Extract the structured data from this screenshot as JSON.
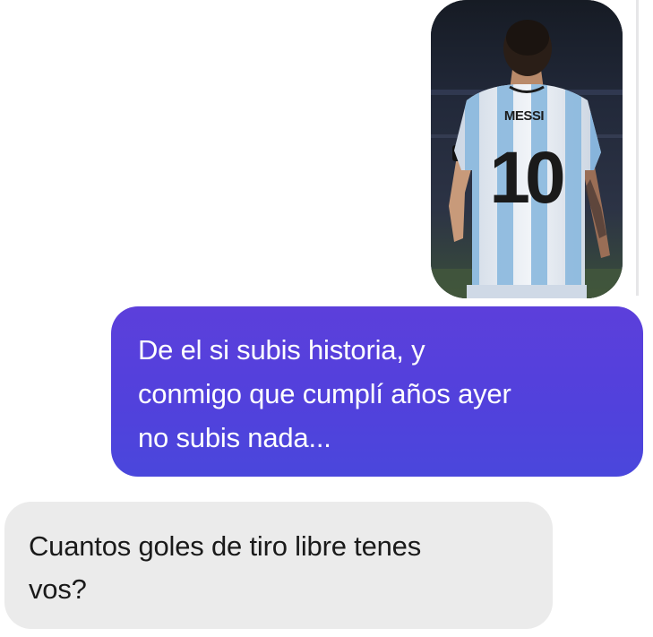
{
  "conversation": {
    "shared_image": {
      "jersey_name": "MESSI",
      "jersey_number": "10"
    },
    "sent_message": {
      "text": "De el si subis historia, y\nconmigo que cumplí años ayer\nno subis nada..."
    },
    "received_message": {
      "text": "Cuantos goles de tiro libre tenes\nvos?"
    }
  },
  "colors": {
    "sent_bubble": "#5141dc",
    "received_bubble": "#ebebeb",
    "background": "#ffffff",
    "jersey_white": "#eef1f6",
    "jersey_stripe": "#86b6de"
  }
}
